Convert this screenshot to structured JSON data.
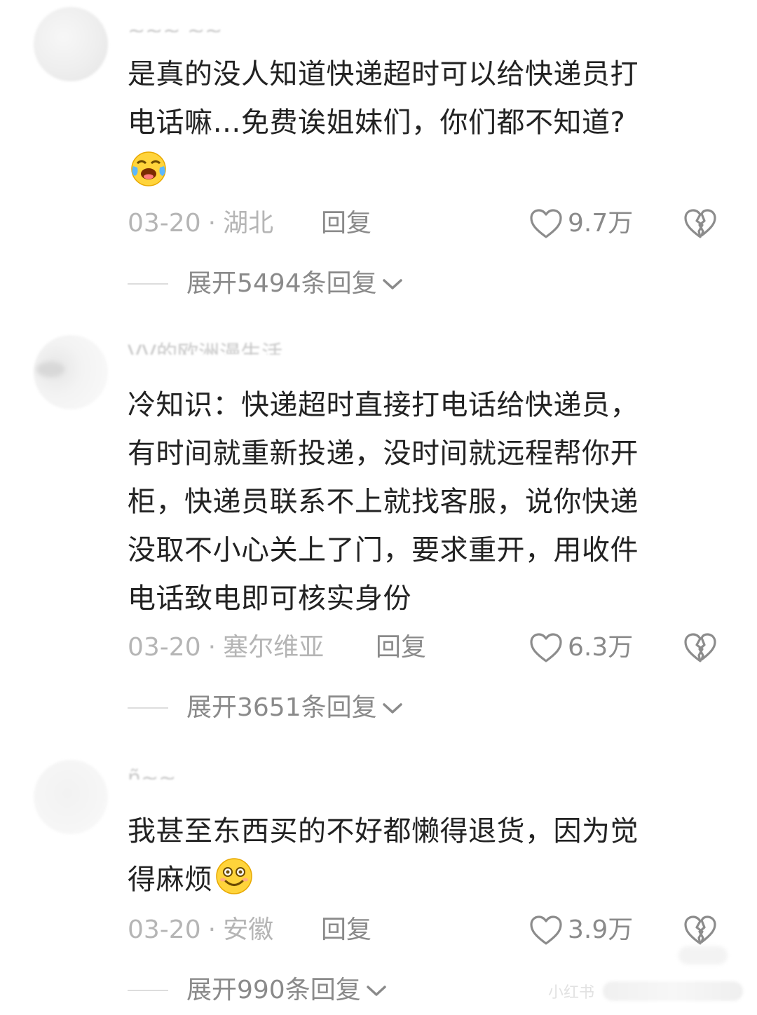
{
  "comments": [
    {
      "username": "~~~ ~~",
      "text_lines": [
        "是真的没人知道快递超时可以给快递员打",
        "电话嘛…免费诶姐妹们，你们都不知道?"
      ],
      "emoji_icon": "crying-laughing-emoji-icon",
      "date": "03-20",
      "location": "湖北",
      "reply_label": "回复",
      "likes": "9.7万",
      "expand_label": "展开5494条回复"
    },
    {
      "username": "VV的欧洲漫生活",
      "text_lines": [
        "冷知识：快递超时直接打电话给快递员，",
        "有时间就重新投递，没时间就远程帮你开",
        "柜，快递员联系不上就找客服，说你快递",
        "没取不小心关上了门，要求重开，用收件",
        "电话致电即可核实身份"
      ],
      "date": "03-20",
      "location": "塞尔维亚",
      "reply_label": "回复",
      "likes": "6.3万",
      "expand_label": "展开3651条回复"
    },
    {
      "username": "ñ~~",
      "text_lines": [
        "我甚至东西买的不好都懒得退货，因为觉",
        "得麻烦"
      ],
      "emoji_icon": "smiling-face-emoji-icon",
      "date": "03-20",
      "location": "安徽",
      "reply_label": "回复",
      "likes": "3.9万",
      "expand_label": "展开990条回复"
    }
  ],
  "watermark": "小红书",
  "colors": {
    "text": "#222222",
    "meta": "#b5b5b5",
    "action": "#8a8a8a",
    "icon_stroke": "#8c8c8c"
  }
}
